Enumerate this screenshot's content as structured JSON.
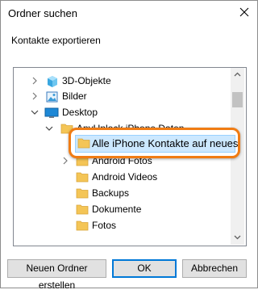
{
  "window": {
    "title": "Ordner suchen",
    "subtitle": "Kontakte exportieren"
  },
  "tree": {
    "items": [
      {
        "label": "3D-Objekte",
        "icon": "3d-objects-icon",
        "expander": "collapsed"
      },
      {
        "label": "Bilder",
        "icon": "pictures-icon",
        "expander": "collapsed"
      },
      {
        "label": "Desktop",
        "icon": "desktop-icon",
        "expander": "expanded"
      },
      {
        "label": "AnyUnlock iPhone Daten",
        "icon": "folder-icon",
        "expander": "expanded"
      },
      {
        "label": "Alle iPhone Kontakte auf neues il",
        "icon": "folder-icon",
        "selected": true
      },
      {
        "label": "Android Fotos",
        "icon": "folder-icon",
        "expander": "collapsed"
      },
      {
        "label": "Android Videos",
        "icon": "folder-icon"
      },
      {
        "label": "Backups",
        "icon": "folder-icon"
      },
      {
        "label": "Dokumente",
        "icon": "folder-icon"
      },
      {
        "label": "Fotos",
        "icon": "folder-icon"
      }
    ]
  },
  "buttons": {
    "new_folder": "Neuen Ordner erstellen",
    "ok": "OK",
    "cancel": "Abbrechen"
  },
  "colors": {
    "highlight_border": "#f07c14",
    "selection": "#cce8ff",
    "folder": "#f4c556",
    "desktop": "#1e88d6"
  }
}
